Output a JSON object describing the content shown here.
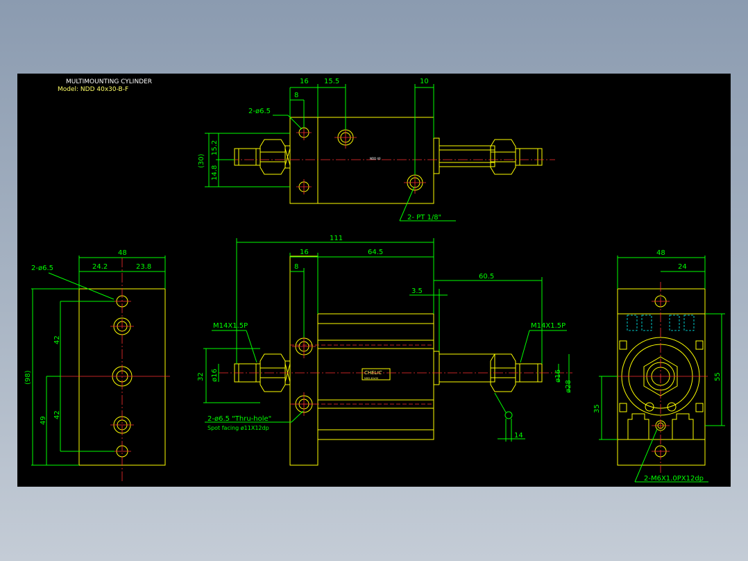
{
  "title": "MULTIMOUNTING CYLINDER",
  "model": "Model: NDD 40x30-B-F",
  "top_view": {
    "dims": {
      "d16": "16",
      "d15_5": "15.5",
      "d10": "10",
      "d8": "8",
      "d15_2": "15.2",
      "d14_8": "14.8",
      "d30": "(30)"
    },
    "hole_note": "2-ø6.5",
    "port_note": "2- PT 1/8\"",
    "tiny_text": "NDD 40"
  },
  "front_view": {
    "dims": {
      "d111": "111",
      "d16": "16",
      "d64_5": "64.5",
      "d8": "8",
      "d60_5": "60.5",
      "d3_5": "3.5",
      "d32": "32",
      "d14": "14"
    },
    "thread_left": "M14X1.5P",
    "thread_right": "M14X1.5P",
    "dia16_left": "ø16",
    "dia16_right": "ø16",
    "dia28": "ø28",
    "hole_note": "2-ø6.5 \"Thru-hole\"",
    "spot_note": "Spot facing ø11X12dp",
    "logo": "CHELIC",
    "logo_sub": "NDD 40x30"
  },
  "left_view": {
    "dims": {
      "d48": "48",
      "d24_2": "24.2",
      "d23_8": "23.8",
      "d98": "(98)",
      "d42a": "42",
      "d42b": "42",
      "d49": "49"
    },
    "hole_note": "2-ø6.5"
  },
  "right_view": {
    "dims": {
      "d48": "48",
      "d24": "24",
      "d55": "55",
      "d35": "35"
    },
    "thread_note": "2-M6X1.0PX12dp"
  }
}
